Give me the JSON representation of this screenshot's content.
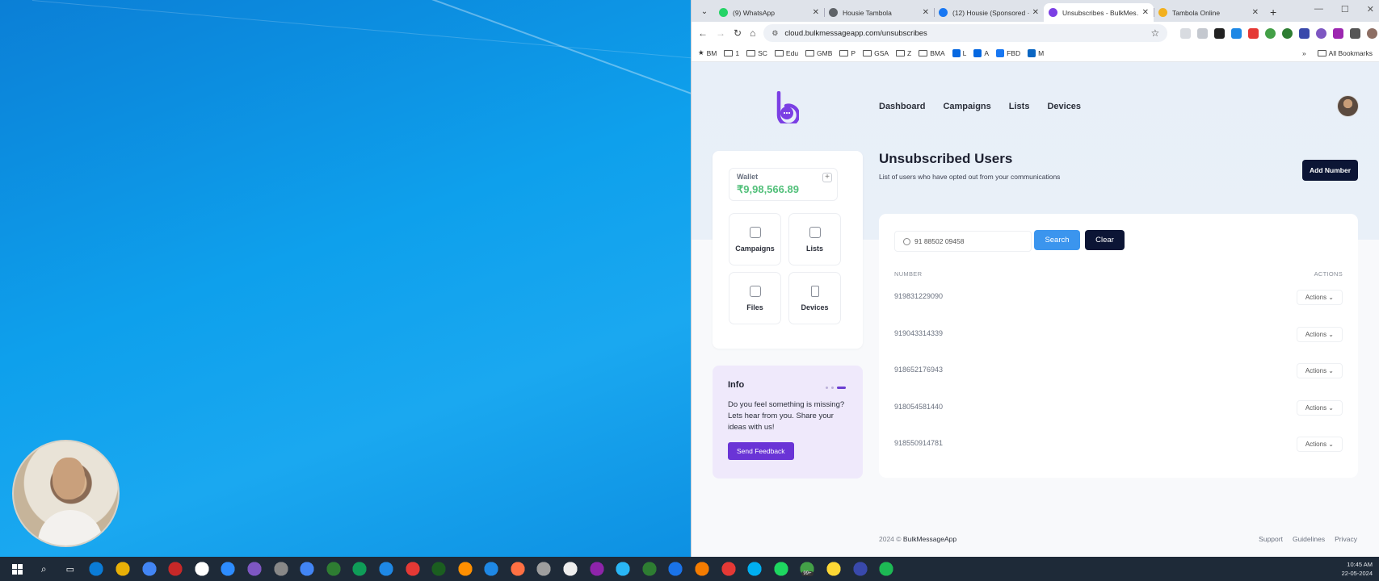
{
  "browser": {
    "tabs": [
      {
        "title": "(9) WhatsApp",
        "color": "#25d366",
        "active": false
      },
      {
        "title": "Housie Tambola",
        "color": "#5f6368",
        "active": false
      },
      {
        "title": "(12) Housie (Sponsored ·",
        "color": "#1877f2",
        "active": false
      },
      {
        "title": "Unsubscribes - BulkMes…",
        "color": "#7b3fe4",
        "active": true
      },
      {
        "title": "Tambola Online",
        "color": "#f2b01e",
        "active": false
      }
    ],
    "url": "cloud.bulkmessageapp.com/unsubscribes",
    "bookmarks": [
      {
        "label": "BM",
        "type": "star"
      },
      {
        "label": "1",
        "type": "folder"
      },
      {
        "label": "SC",
        "type": "folder"
      },
      {
        "label": "Edu",
        "type": "folder"
      },
      {
        "label": "GMB",
        "type": "folder"
      },
      {
        "label": "P",
        "type": "folder"
      },
      {
        "label": "GSA",
        "type": "folder"
      },
      {
        "label": "Z",
        "type": "folder"
      },
      {
        "label": "BMA",
        "type": "folder"
      },
      {
        "label": "L",
        "type": "meta"
      },
      {
        "label": "A",
        "type": "meta"
      },
      {
        "label": "FBD",
        "type": "fb"
      },
      {
        "label": "M",
        "type": "linkedin"
      }
    ],
    "all_bookmarks": "All Bookmarks"
  },
  "app": {
    "nav": [
      "Dashboard",
      "Campaigns",
      "Lists",
      "Devices"
    ],
    "wallet": {
      "label": "Wallet",
      "value": "₹9,98,566.89"
    },
    "tiles": [
      "Campaigns",
      "Lists",
      "Files",
      "Devices"
    ],
    "info": {
      "title": "Info",
      "body": "Do you feel something is missing? Lets hear from you. Share your ideas with us!",
      "button": "Send Feedback"
    },
    "page_title": "Unsubscribed Users",
    "page_subtitle": "List of users who have opted out from your communications",
    "add_button": "Add Number",
    "search": {
      "value": "91 88502 09458",
      "button": "Search",
      "clear": "Clear"
    },
    "table": {
      "col_number": "NUMBER",
      "col_actions": "ACTIONS",
      "action_label": "Actions",
      "rows": [
        "919831229090",
        "919043314339",
        "918652176943",
        "918054581440",
        "918550914781"
      ]
    },
    "footer": {
      "year": "2024 ©",
      "brand": "BulkMessageApp",
      "links": [
        "Support",
        "Guidelines",
        "Privacy"
      ]
    }
  },
  "taskbar": {
    "time": "10:45 AM",
    "date": "22-05-2024",
    "badge": "99+"
  }
}
